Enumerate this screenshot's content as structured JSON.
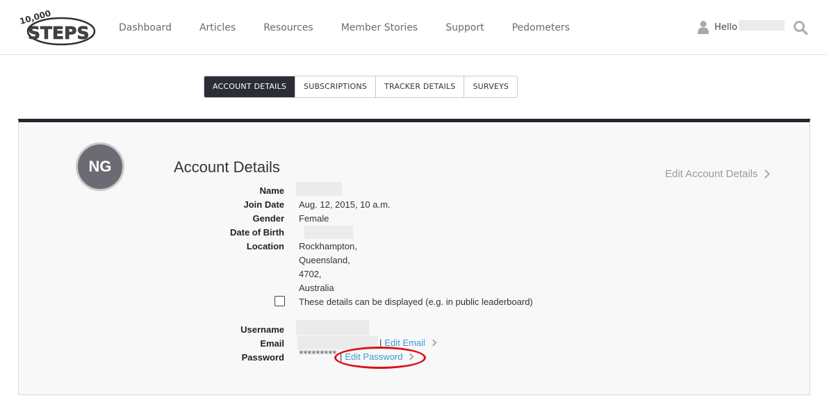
{
  "header": {
    "logo_text": "10,000 STEPS",
    "nav": [
      "Dashboard",
      "Articles",
      "Resources",
      "Member Stories",
      "Support",
      "Pedometers"
    ],
    "greeting": "Hello"
  },
  "tabs": [
    {
      "label": "ACCOUNT DETAILS",
      "active": true
    },
    {
      "label": "SUBSCRIPTIONS",
      "active": false
    },
    {
      "label": "TRACKER DETAILS",
      "active": false
    },
    {
      "label": "SURVEYS",
      "active": false
    }
  ],
  "account": {
    "avatar_initials": "NG",
    "title": "Account Details",
    "edit_account_label": "Edit Account Details",
    "labels": {
      "name": "Name",
      "join_date": "Join Date",
      "gender": "Gender",
      "dob": "Date of Birth",
      "location": "Location",
      "username": "Username",
      "email": "Email",
      "password": "Password"
    },
    "join_date": "Aug. 12, 2015, 10 a.m.",
    "gender": "Female",
    "location_lines": [
      "Rockhampton,",
      "Queensland,",
      "4702,",
      "Australia"
    ],
    "display_consent_label": "These details can be displayed (e.g. in public leaderboard)",
    "display_consent_checked": false,
    "separator": "|",
    "edit_email_label": "Edit Email",
    "password_mask": "*********",
    "edit_password_label": "Edit Password"
  },
  "colors": {
    "accent_dark": "#2b2e36",
    "link": "#3a9ad9",
    "annotation": "#d9121b"
  }
}
